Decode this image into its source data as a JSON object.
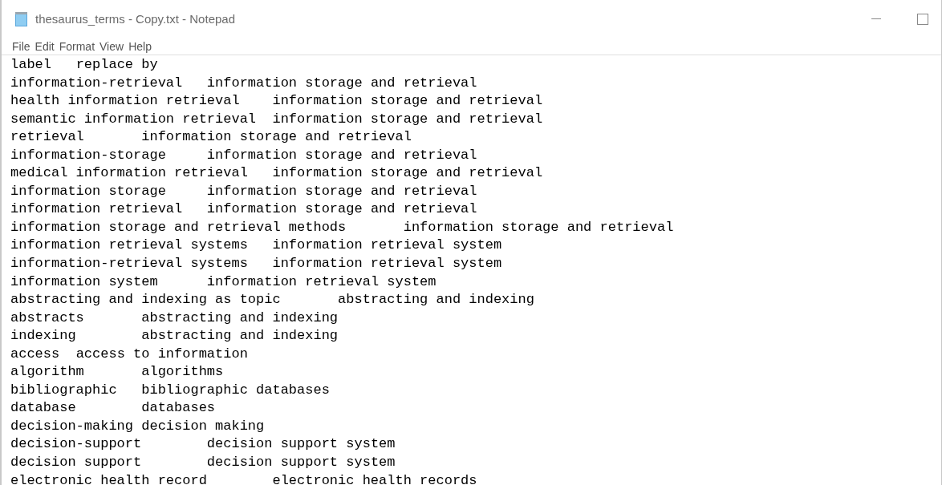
{
  "window": {
    "title": "thesaurus_terms - Copy.txt - Notepad"
  },
  "menu": [
    "File",
    "Edit",
    "Format",
    "View",
    "Help"
  ],
  "lines": [
    "label\treplace by",
    "information-retrieval\tinformation storage and retrieval",
    "health information retrieval\tinformation storage and retrieval",
    "semantic information retrieval\tinformation storage and retrieval",
    "retrieval\tinformation storage and retrieval",
    "information-storage\tinformation storage and retrieval",
    "medical information retrieval\tinformation storage and retrieval",
    "information storage\tinformation storage and retrieval",
    "information retrieval\tinformation storage and retrieval",
    "information storage and retrieval methods\tinformation storage and retrieval",
    "information retrieval systems\tinformation retrieval system",
    "information-retrieval systems\tinformation retrieval system",
    "information system\tinformation retrieval system",
    "abstracting and indexing as topic\tabstracting and indexing",
    "abstracts\tabstracting and indexing",
    "indexing\tabstracting and indexing",
    "access\taccess to information",
    "algorithm\talgorithms",
    "bibliographic\tbibliographic databases",
    "database\tdatabases",
    "decision-making\tdecision making",
    "decision-support\tdecision support system",
    "decision support\tdecision support system",
    "electronic health record\telectronic health records"
  ]
}
